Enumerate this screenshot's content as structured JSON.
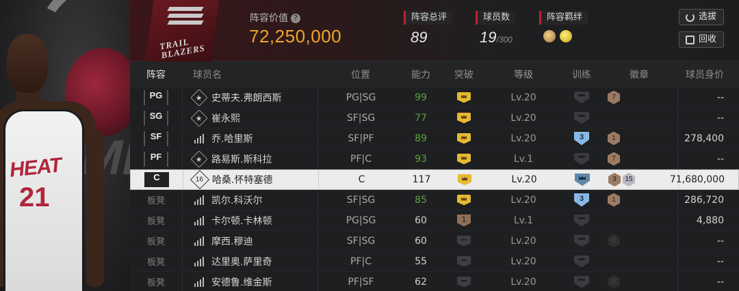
{
  "header": {
    "value_label": "阵容价值",
    "help_icon": "question-mark",
    "value": "72,250,000",
    "rating_label": "阵容总评",
    "rating": "89",
    "count_label": "球员数",
    "count": "19",
    "count_max": "/300",
    "bond_label": "阵容羁绊",
    "pick_button": "选拔",
    "back_button": "回收"
  },
  "logo_text": "TRAIL BLAZERS",
  "columns": {
    "lineup": "阵容",
    "name": "球员名",
    "position": "位置",
    "ability": "能力",
    "breakthrough": "突破",
    "level": "等级",
    "training": "训练",
    "badge": "徽章",
    "value": "球员身价"
  },
  "rows": [
    {
      "slot": "PG",
      "name": "史蒂夫.弗朗西斯",
      "pos": "PG|SG",
      "ability": "99",
      "level": "Lv.20",
      "value": "--"
    },
    {
      "slot": "SG",
      "name": "崔永熙",
      "pos": "SF|SG",
      "ability": "77",
      "level": "Lv.20",
      "value": "--"
    },
    {
      "slot": "SF",
      "name": "乔.哈里斯",
      "pos": "SF|PF",
      "ability": "89",
      "level": "Lv.20",
      "value": "278,400",
      "train": "3"
    },
    {
      "slot": "PF",
      "name": "路易斯.斯科拉",
      "pos": "PF|C",
      "ability": "93",
      "level": "Lv.1",
      "value": "--"
    },
    {
      "slot": "C",
      "name": "哈桑.怀特塞德",
      "pos": "C",
      "ability": "117",
      "level": "Lv.20",
      "value": "71,680,000",
      "rank": "16",
      "badge1": "3",
      "badge2": "15"
    },
    {
      "slot": "板凳",
      "name": "凯尔.科沃尔",
      "pos": "SF|SG",
      "ability": "85",
      "level": "Lv.20",
      "value": "286,720",
      "train": "3"
    },
    {
      "slot": "板凳",
      "name": "卡尔顿.卡林顿",
      "pos": "PG|SG",
      "ability": "60",
      "level": "Lv.1",
      "value": "4,880",
      "break": "1"
    },
    {
      "slot": "板凳",
      "name": "摩西.穆迪",
      "pos": "SF|SG",
      "ability": "60",
      "level": "Lv.20",
      "value": "--"
    },
    {
      "slot": "板凳",
      "name": "达里奥.萨里奇",
      "pos": "PF|C",
      "ability": "55",
      "level": "Lv.20",
      "value": "--"
    },
    {
      "slot": "板凳",
      "name": "安德鲁.维金斯",
      "pos": "PF|SF",
      "ability": "62",
      "level": "Lv.20",
      "value": "--"
    }
  ],
  "badges": {
    "b7": "7",
    "b1": "1",
    "b0": "0"
  },
  "colors": {
    "accent_gold": "#f0a52a",
    "ability_green": "#5ca53d",
    "header_red": "#c2222e"
  }
}
